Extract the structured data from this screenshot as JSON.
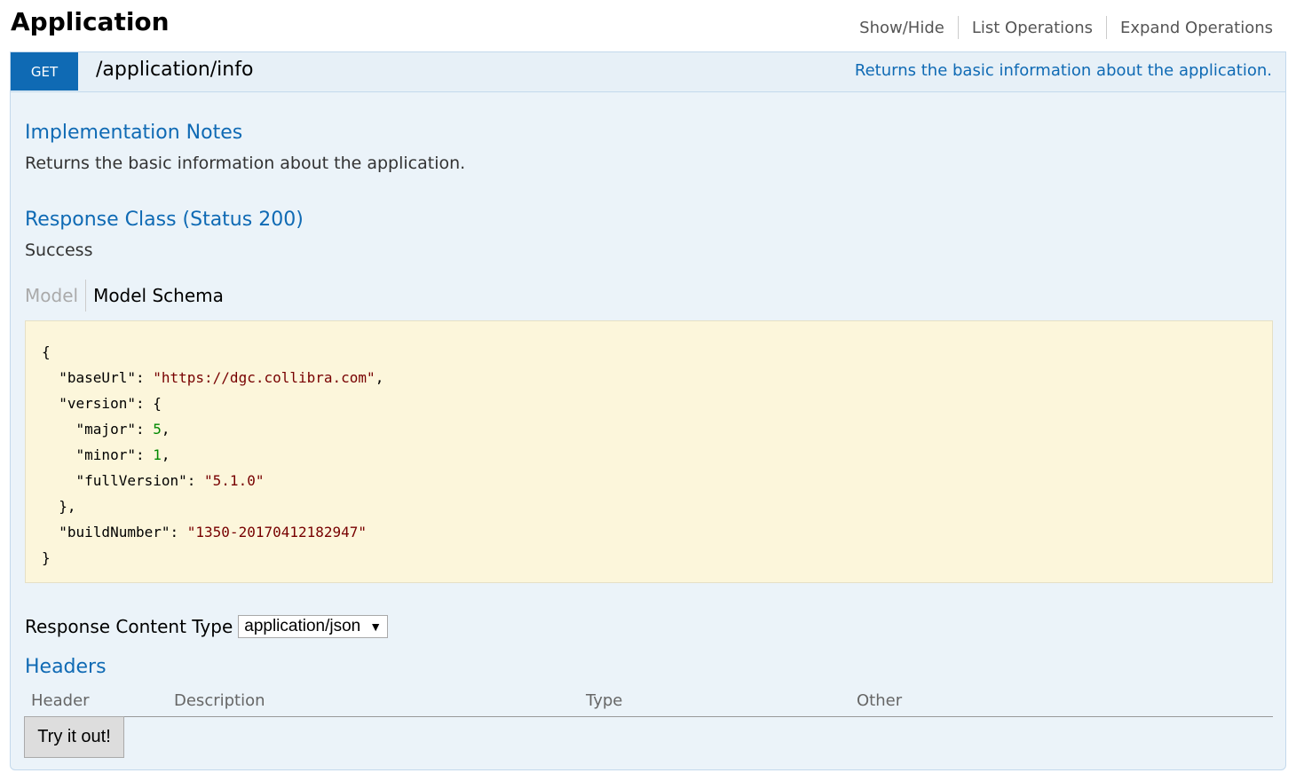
{
  "header": {
    "title": "Application",
    "links": [
      "Show/Hide",
      "List Operations",
      "Expand Operations"
    ]
  },
  "operation": {
    "method": "GET",
    "path": "/application/info",
    "summary": "Returns the basic information about the application.",
    "implementation_notes_title": "Implementation Notes",
    "implementation_notes": "Returns the basic information about the application.",
    "response_class_title": "Response Class (Status 200)",
    "response_class_text": "Success",
    "tabs": {
      "model": "Model",
      "schema": "Model Schema"
    },
    "schema": {
      "baseUrl_key": "\"baseUrl\"",
      "baseUrl": "\"https://dgc.collibra.com\"",
      "version_key": "\"version\"",
      "major_key": "\"major\"",
      "major": "5",
      "minor_key": "\"minor\"",
      "minor": "1",
      "fullVersion_key": "\"fullVersion\"",
      "fullVersion": "\"5.1.0\"",
      "buildNumber_key": "\"buildNumber\"",
      "buildNumber": "\"1350-20170412182947\""
    },
    "response_content_type_label": "Response Content Type",
    "response_content_type": "application/json",
    "headers_title": "Headers",
    "headers_columns": [
      "Header",
      "Description",
      "Type",
      "Other"
    ],
    "try_button": "Try it out!"
  },
  "colors": {
    "get_badge": "#0f6ab4",
    "link_blue": "#0f6ab4",
    "panel_bg": "#ebf3f9",
    "schema_bg": "#fcf6db"
  }
}
